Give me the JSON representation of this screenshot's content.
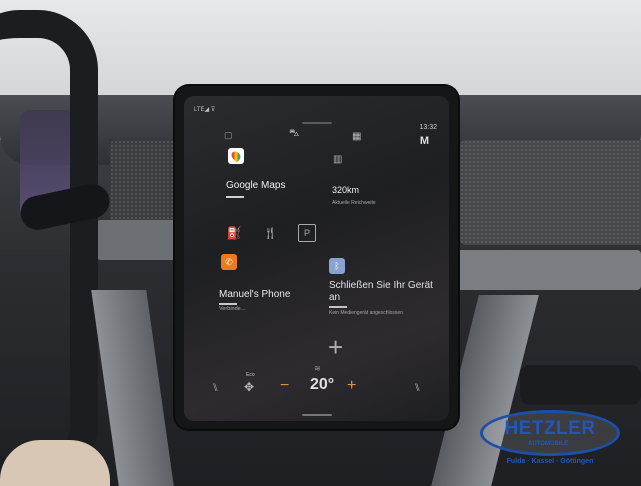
{
  "screen": {
    "status_left": "LTE◢ ⊽",
    "clock": "13:32",
    "profile_letter": "M",
    "tiles": {
      "maps": {
        "label": "Google Maps"
      },
      "range": {
        "value": "320km",
        "sub": "Aktuelle Reichweite"
      },
      "phone": {
        "label": "Manuel's Phone",
        "sub": "Verbinde..."
      },
      "bluetooth": {
        "label": "Schließen Sie Ihr Gerät an",
        "sub": "Kein Mediengerät angeschlossen"
      }
    },
    "poi_icons": [
      "fuel-station-icon",
      "restaurant-icon",
      "parking-icon"
    ],
    "climate": {
      "eco_label": "Eco",
      "temperature": "20°",
      "minus": "−",
      "plus": "+"
    }
  },
  "dealer": {
    "name": "HETZLER",
    "sub": "AUTOMOBILE",
    "cities": "Fulda · Kassel · Göttingen"
  }
}
